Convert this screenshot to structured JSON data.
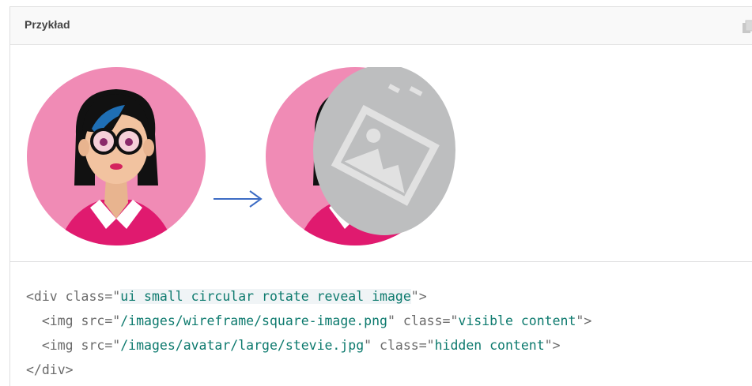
{
  "example": {
    "title": "Przykład",
    "copy_icon": "copy-icon"
  },
  "demo": {
    "visible_image": "avatar-image",
    "arrow": "arrow-right-icon",
    "reveal_image": "wireframe-image-placeholder",
    "colors": {
      "pink_bg": "#f08bb5",
      "magenta_shirt": "#e01a6f",
      "gray_overlay": "#bdbebf"
    }
  },
  "code": {
    "line1": {
      "open": "<div class=\"",
      "value": "ui small circular rotate reveal image",
      "close": "\">"
    },
    "line2": {
      "indent": "  ",
      "open": "<img src=\"",
      "src": "/images/wireframe/square-image.png",
      "mid": "\" class=\"",
      "cls": "visible content",
      "close": "\">"
    },
    "line3": {
      "indent": "  ",
      "open": "<img src=\"",
      "src": "/images/avatar/large/stevie.jpg",
      "mid": "\" class=\"",
      "cls": "hidden content",
      "close": "\">"
    },
    "line4": "</div>"
  }
}
